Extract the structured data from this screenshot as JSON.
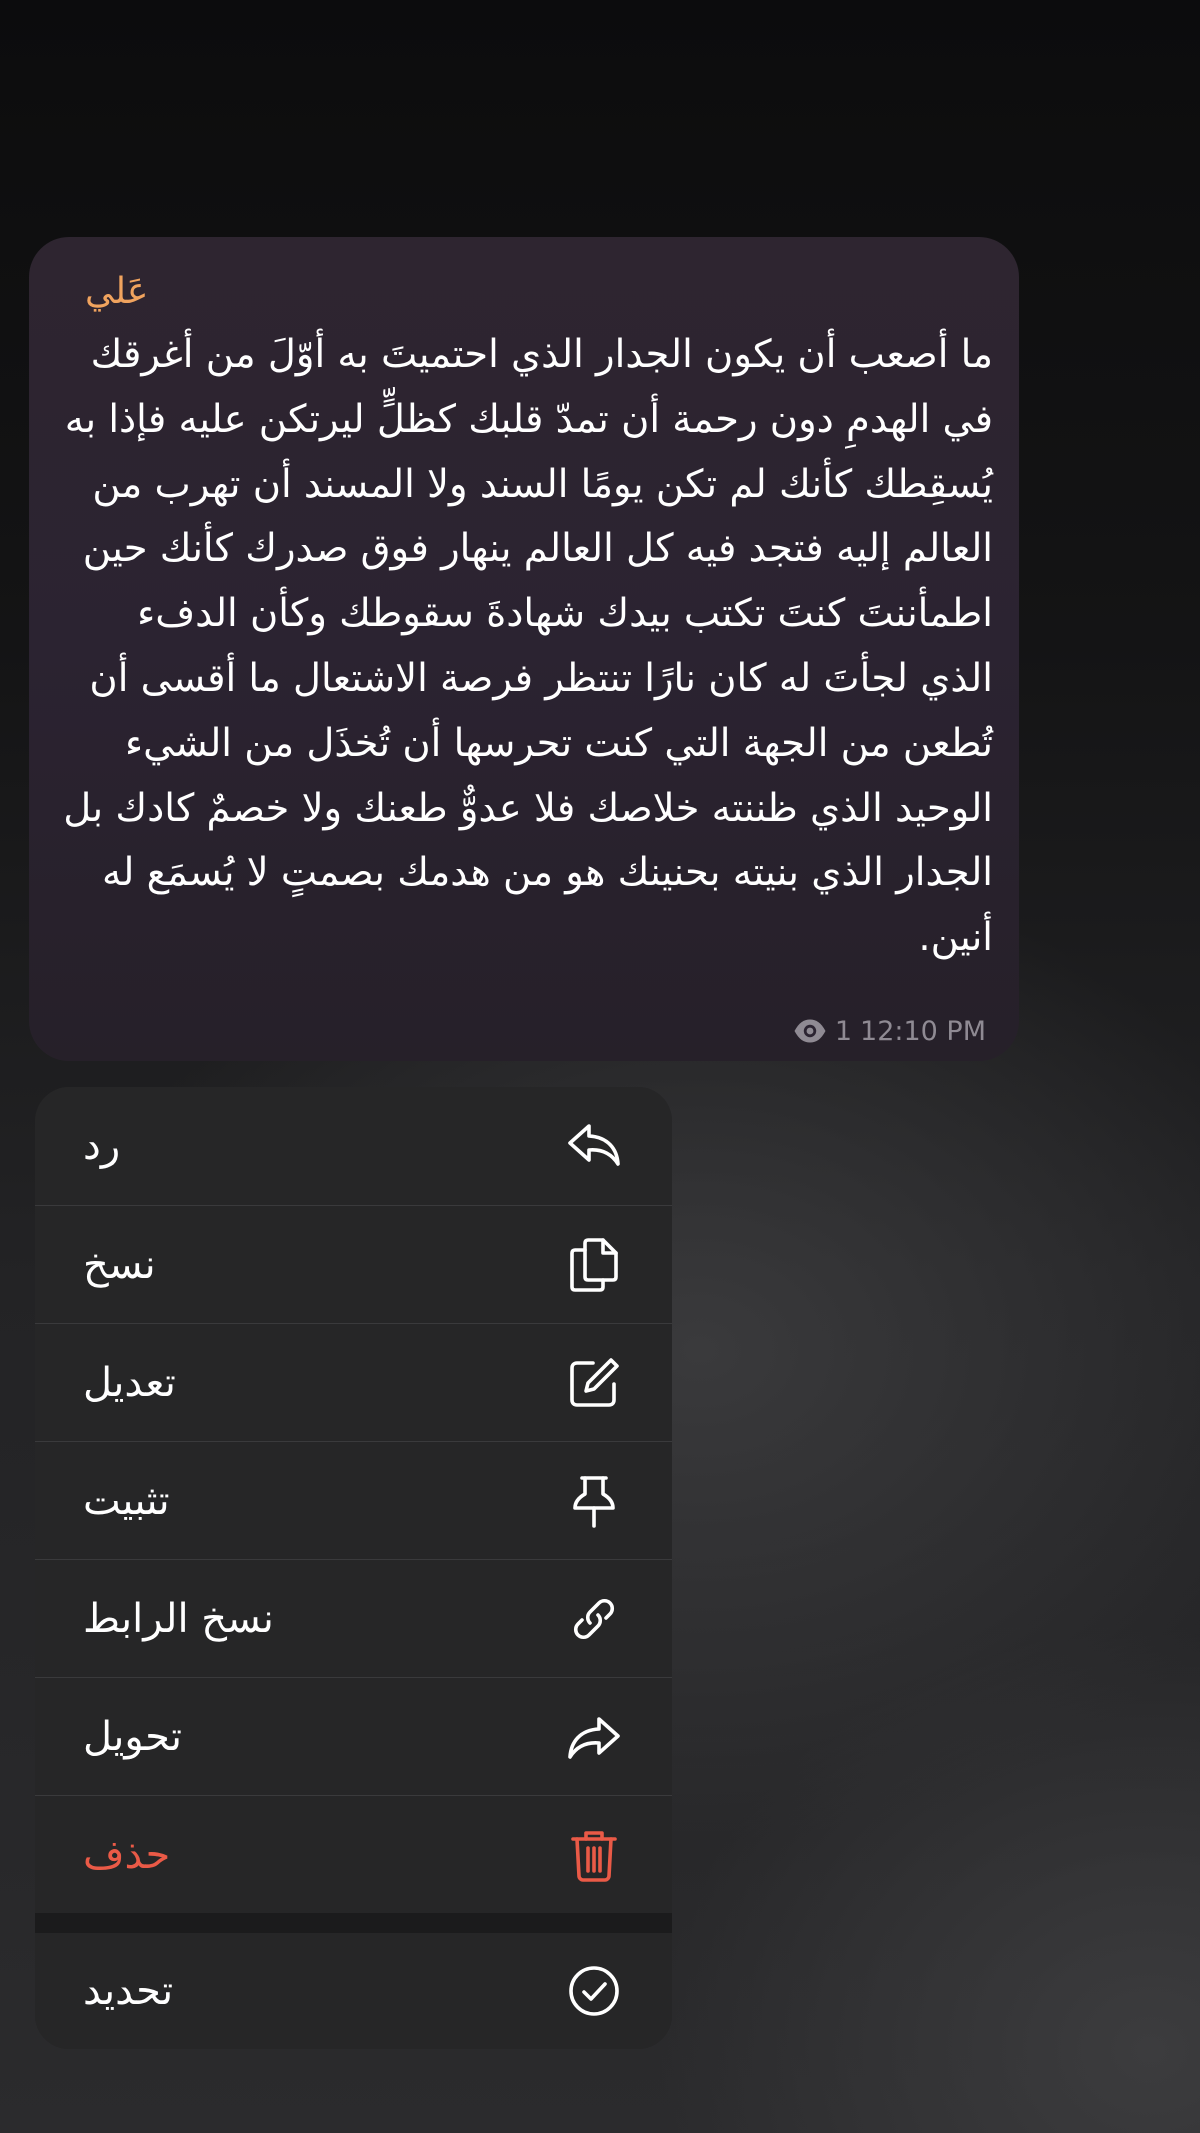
{
  "message": {
    "sender": "عَلي",
    "text": "ما أصعب أن يكون الجدار الذي احتميتَ به أوّلَ من أغرقك في الهدمِ دون رحمة أن تمدّ قلبك كظلٍّ ليرتكن عليه فإذا به يُسقِطك كأنك لم تكن يومًا السند ولا المسند أن تهرب من العالم إليه فتجد فيه كل العالم ينهار فوق صدرك كأنك حين اطمأننتَ كنتَ تكتب بيدك شهادةَ سقوطك وكأن الدفء الذي لجأتَ له كان نارًا تنتظر فرصة الاشتعال ما أقسى أن تُطعن من الجهة التي كنت تحرسها أن تُخذَل من الشيء الوحيد الذي ظننته خلاصك فلا عدوٌّ طعنك ولا خصمٌ كادك بل الجدار الذي بنيته بحنينك هو من هدمك بصمتٍ لا يُسمَع له أنين.",
    "views": "1",
    "time": "12:10 PM"
  },
  "menu": {
    "items": [
      {
        "label": "رد",
        "icon": "reply-icon"
      },
      {
        "label": "نسخ",
        "icon": "copy-icon"
      },
      {
        "label": "تعديل",
        "icon": "edit-icon"
      },
      {
        "label": "تثبيت",
        "icon": "pin-icon"
      },
      {
        "label": "نسخ الرابط",
        "icon": "link-icon"
      },
      {
        "label": "تحويل",
        "icon": "forward-icon"
      },
      {
        "label": "حذف",
        "icon": "trash-icon"
      },
      {
        "label": "تحديد",
        "icon": "check-circle-icon"
      }
    ]
  },
  "colors": {
    "accent_sender": "#f0a35e",
    "danger": "#ea5a47",
    "bubble": "#2b2331",
    "menu_bg": "#262627"
  }
}
